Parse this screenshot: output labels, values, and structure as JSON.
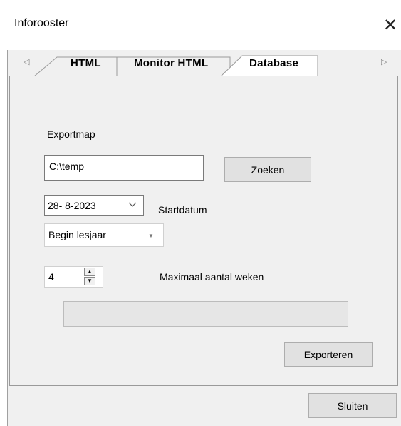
{
  "window": {
    "title": "Inforooster",
    "close_symbol": "✕"
  },
  "tabs": [
    {
      "label": "HTML",
      "selected": false
    },
    {
      "label": "Monitor HTML",
      "selected": false
    },
    {
      "label": "Database",
      "selected": true
    }
  ],
  "tab_scroll": {
    "left_icon": "tab-scroll-left-icon",
    "right_icon": "tab-scroll-right-icon",
    "left_glyph": "◁",
    "right_glyph": "▷"
  },
  "export": {
    "folder_label": "Exportmap",
    "folder_value": "C:\\temp",
    "browse_button": "Zoeken",
    "date_value": "28- 8-2023",
    "date_label": "Startdatum",
    "start_option": "Begin lesjaar",
    "weeks_value": "4",
    "weeks_label": "Maximaal aantal weken",
    "progress": 0,
    "export_button": "Exporteren"
  },
  "footer": {
    "close_button": "Sluiten"
  },
  "colors": {
    "background": "#f0f0f0",
    "button": "#e1e1e1",
    "border": "#adadad",
    "progress_fill": "#06b025"
  }
}
